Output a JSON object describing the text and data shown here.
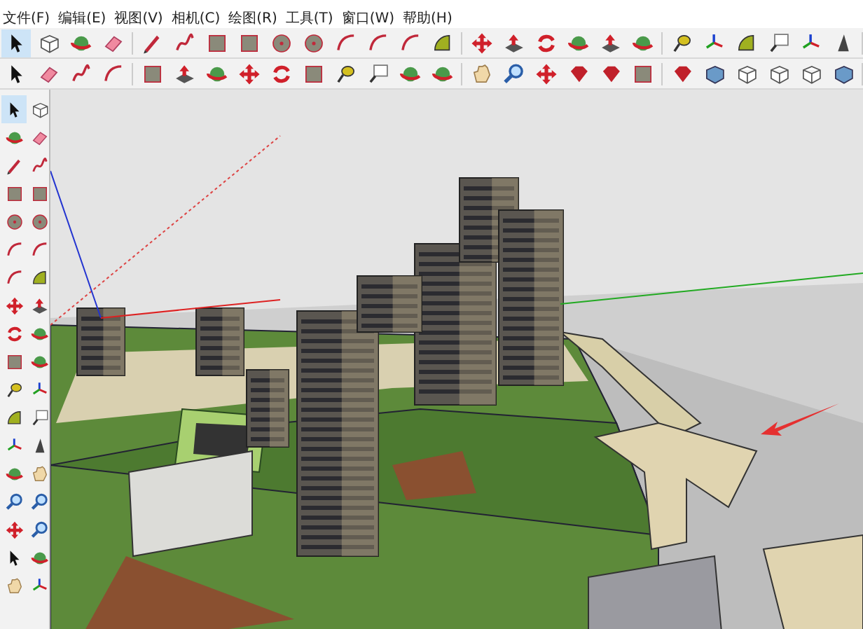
{
  "menu_bar": {
    "items": [
      {
        "label": "文件(F)"
      },
      {
        "label": "编辑(E)"
      },
      {
        "label": "视图(V)"
      },
      {
        "label": "相机(C)"
      },
      {
        "label": "绘图(R)"
      },
      {
        "label": "工具(T)"
      },
      {
        "label": "窗口(W)"
      },
      {
        "label": "帮助(H)"
      }
    ]
  }
}
